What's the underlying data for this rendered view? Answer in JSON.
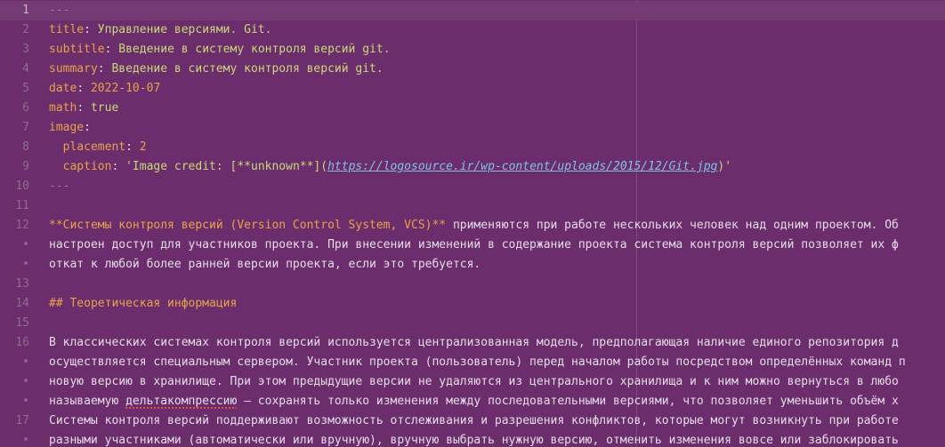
{
  "editor": {
    "lines": [
      {
        "n": "1",
        "current": true,
        "segments": [
          {
            "t": "---",
            "c": "dash"
          }
        ]
      },
      {
        "n": "2",
        "segments": [
          {
            "t": "title",
            "c": "key"
          },
          {
            "t": ": ",
            "c": "plain"
          },
          {
            "t": "Управление версиями. Git.",
            "c": "str"
          }
        ]
      },
      {
        "n": "3",
        "segments": [
          {
            "t": "subtitle",
            "c": "key"
          },
          {
            "t": ": ",
            "c": "plain"
          },
          {
            "t": "Введение в систему контроля версий git.",
            "c": "str"
          }
        ]
      },
      {
        "n": "4",
        "segments": [
          {
            "t": "summary",
            "c": "key"
          },
          {
            "t": ": ",
            "c": "plain"
          },
          {
            "t": "Введение в систему контроля версий git.",
            "c": "str"
          }
        ]
      },
      {
        "n": "5",
        "segments": [
          {
            "t": "date",
            "c": "key"
          },
          {
            "t": ": ",
            "c": "plain"
          },
          {
            "t": "2022-10-07",
            "c": "num"
          }
        ]
      },
      {
        "n": "6",
        "segments": [
          {
            "t": "math",
            "c": "key"
          },
          {
            "t": ": ",
            "c": "plain"
          },
          {
            "t": "true",
            "c": "str"
          }
        ]
      },
      {
        "n": "7",
        "segments": [
          {
            "t": "image",
            "c": "key"
          },
          {
            "t": ":",
            "c": "plain"
          }
        ]
      },
      {
        "n": "8",
        "segments": [
          {
            "t": "  placement",
            "c": "key"
          },
          {
            "t": ": ",
            "c": "plain"
          },
          {
            "t": "2",
            "c": "num"
          }
        ]
      },
      {
        "n": "9",
        "segments": [
          {
            "t": "  caption",
            "c": "key"
          },
          {
            "t": ": ",
            "c": "plain"
          },
          {
            "t": "'Image credit: [**unknown**](",
            "c": "str"
          },
          {
            "t": "https://logosource.ir/wp-content/uploads/2015/12/Git.jpg",
            "c": "link"
          },
          {
            "t": ")'",
            "c": "str"
          }
        ]
      },
      {
        "n": "10",
        "segments": [
          {
            "t": "---",
            "c": "dash"
          }
        ]
      },
      {
        "n": "11",
        "segments": []
      },
      {
        "n": "12",
        "segments": [
          {
            "t": "**Системы контроля версий (Version Control System, VCS)**",
            "c": "bold"
          },
          {
            "t": " применяются при работе нескольких человек над одним проектом. Об",
            "c": "plain"
          }
        ]
      },
      {
        "n": "•",
        "dot": true,
        "segments": [
          {
            "t": "настроен доступ для участников проекта. При внесении изменений в содержание проекта система контроля версий позволяет их ф",
            "c": "plain"
          }
        ]
      },
      {
        "n": "•",
        "dot": true,
        "segments": [
          {
            "t": "откат к любой более ранней версии проекта, если это требуется.",
            "c": "plain"
          }
        ]
      },
      {
        "n": "13",
        "segments": []
      },
      {
        "n": "14",
        "segments": [
          {
            "t": "## Теоретическая информация",
            "c": "head"
          }
        ]
      },
      {
        "n": "15",
        "segments": []
      },
      {
        "n": "16",
        "segments": [
          {
            "t": "В классических системах контроля версий используется централизованная модель, предполагающая наличие единого репозитория д",
            "c": "plain"
          }
        ]
      },
      {
        "n": "•",
        "dot": true,
        "segments": [
          {
            "t": "осуществляется специальным сервером. Участник проекта (пользователь) перед началом работы посредством определённых команд п",
            "c": "plain"
          }
        ]
      },
      {
        "n": "•",
        "dot": true,
        "segments": [
          {
            "t": "новую версию в хранилище. При этом предыдущие версии не удаляются из центрального хранилища и к ним можно вернуться в любо",
            "c": "plain"
          }
        ]
      },
      {
        "n": "•",
        "dot": true,
        "segments": [
          {
            "t": "называемую ",
            "c": "plain"
          },
          {
            "t": "дельтакомпрессию",
            "c": "plain spell"
          },
          {
            "t": " — сохранять только изменения между последовательными версиями, что позволяет уменьшить объём х",
            "c": "plain"
          }
        ]
      },
      {
        "n": "17",
        "segments": [
          {
            "t": "Системы контроля версий поддерживают возможность отслеживания и разрешения конфликтов, которые могут возникнуть при работе ",
            "c": "plain"
          }
        ]
      },
      {
        "n": "•",
        "dot": true,
        "segments": [
          {
            "t": "разными участниками (автоматически или вручную), вручную выбрать нужную версию, отменить изменения вовсе или заблокировать ",
            "c": "plain"
          }
        ]
      }
    ]
  }
}
